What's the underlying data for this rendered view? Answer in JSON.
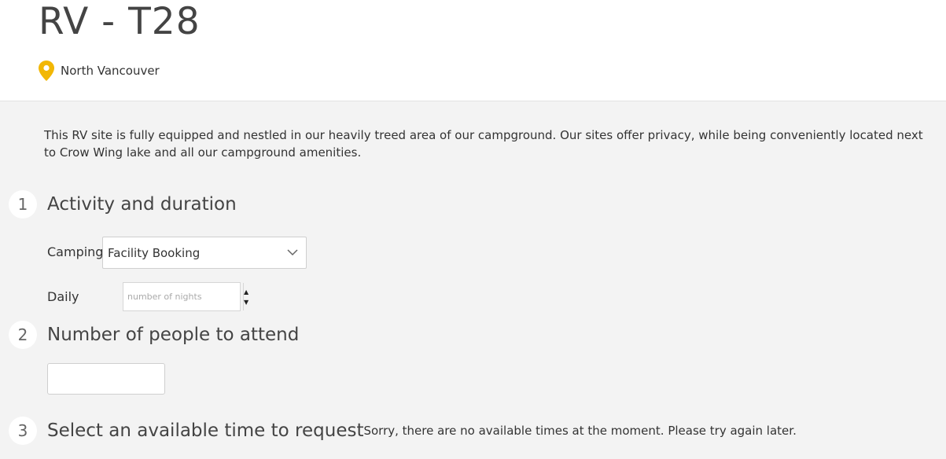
{
  "header": {
    "title": "RV - T28",
    "location": "North Vancouver",
    "location_icon": "map-pin-icon",
    "accent_color": "#f2b705"
  },
  "description": "This RV site is fully equipped and nestled in our heavily treed area of our campground. Our sites offer privacy, while being conveniently located next to Crow Wing lake and all our campground amenities.",
  "steps": [
    {
      "number": "1",
      "title": "Activity and duration"
    },
    {
      "number": "2",
      "title": "Number of people to attend"
    },
    {
      "number": "3",
      "title": "Select an available time to request",
      "note": "Sorry, there are no available times at the moment. Please try again later."
    }
  ],
  "activity": {
    "label": "Camping",
    "selected": "Facility Booking"
  },
  "duration": {
    "label": "Daily",
    "placeholder": "number of nights",
    "up": "▲",
    "down": "▼"
  },
  "people": {
    "value": ""
  }
}
